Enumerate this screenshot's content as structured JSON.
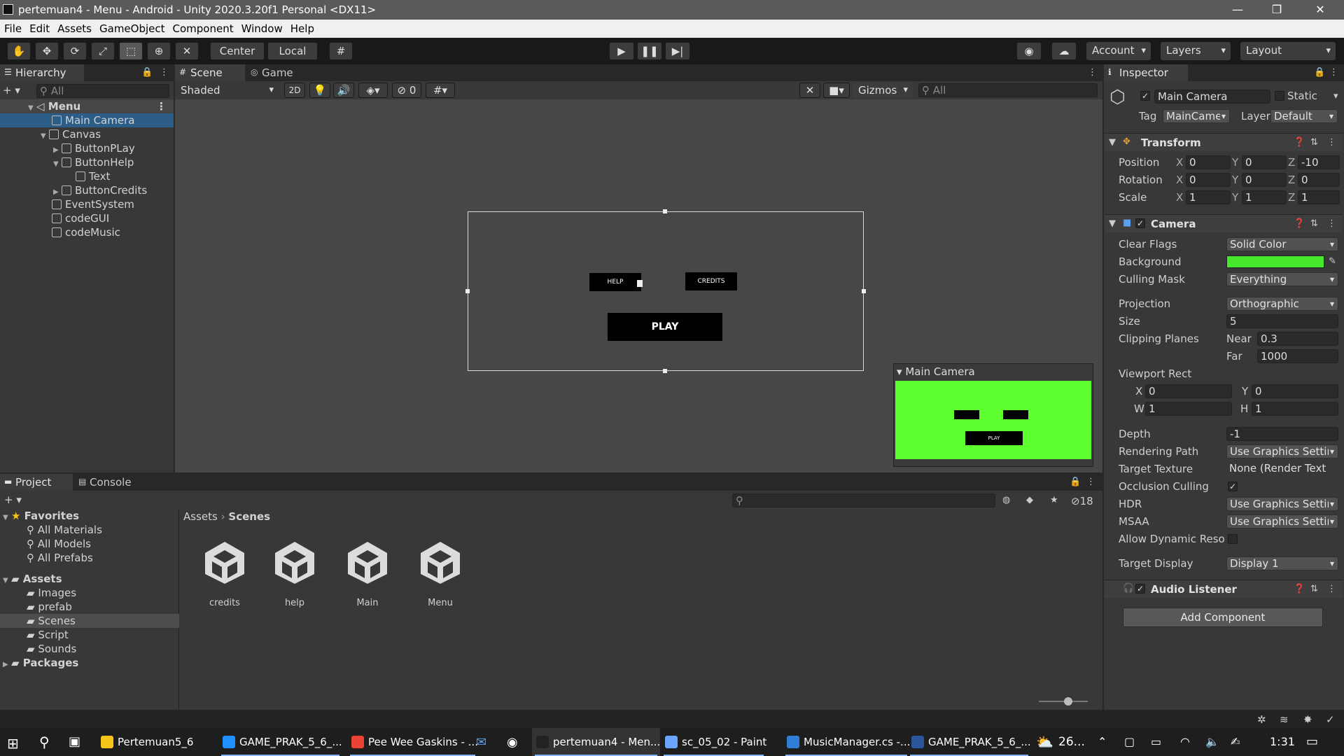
{
  "window": {
    "title": "pertemuan4 - Menu - Android - Unity 2020.3.20f1 Personal <DX11>",
    "minimize": "—",
    "maximize": "❐",
    "close": "✕"
  },
  "menu": [
    "File",
    "Edit",
    "Assets",
    "GameObject",
    "Component",
    "Window",
    "Help"
  ],
  "toolbar": {
    "center": "Center",
    "local": "Local",
    "account": "Account",
    "layers": "Layers",
    "layout": "Layout"
  },
  "hierarchy": {
    "tab": "Hierarchy",
    "search_placeholder": "All",
    "scene": "Menu",
    "items": [
      {
        "label": "Main Camera",
        "selected": true
      },
      {
        "label": "Canvas"
      },
      {
        "label": "ButtonPLay"
      },
      {
        "label": "ButtonHelp"
      },
      {
        "label": "Text"
      },
      {
        "label": "ButtonCredits"
      },
      {
        "label": "EventSystem"
      },
      {
        "label": "codeGUI"
      },
      {
        "label": "codeMusic"
      }
    ]
  },
  "scene": {
    "tabs": [
      "Scene",
      "Game"
    ],
    "shading": "Shaded",
    "mode2d": "2D",
    "hidden_count": "0",
    "gizmos": "Gizmos",
    "search_placeholder": "All",
    "buttons": {
      "help": "HELP",
      "credits": "CREDITS",
      "play": "PLAY"
    },
    "preview_title": "Main Camera",
    "preview_background": "#5dff2e"
  },
  "project": {
    "tabs": [
      "Project",
      "Console"
    ],
    "hidden_count": "18",
    "favorites_label": "Favorites",
    "favorites": [
      "All Materials",
      "All Models",
      "All Prefabs"
    ],
    "assets_label": "Assets",
    "asset_folders": [
      "Images",
      "prefab",
      "Scenes",
      "Script",
      "Sounds"
    ],
    "selected_folder": "Scenes",
    "packages_label": "Packages",
    "breadcrumb": [
      "Assets",
      "Scenes"
    ],
    "breadcrumb_sep": "›",
    "scene_assets": [
      "credits",
      "help",
      "Main",
      "Menu"
    ]
  },
  "inspector": {
    "tab": "Inspector",
    "object_name": "Main Camera",
    "static_label": "Static",
    "tag_label": "Tag",
    "tag_value": "MainCame",
    "layer_label": "Layer",
    "layer_value": "Default",
    "transform": {
      "title": "Transform",
      "position_label": "Position",
      "position": [
        "0",
        "0",
        "-10"
      ],
      "rotation_label": "Rotation",
      "rotation": [
        "0",
        "0",
        "0"
      ],
      "scale_label": "Scale",
      "scale": [
        "1",
        "1",
        "1"
      ],
      "axes": [
        "X",
        "Y",
        "Z"
      ]
    },
    "camera": {
      "title": "Camera",
      "clear_flags_label": "Clear Flags",
      "clear_flags": "Solid Color",
      "background_label": "Background",
      "background_color": "#45e82a",
      "culling_mask_label": "Culling Mask",
      "culling_mask": "Everything",
      "projection_label": "Projection",
      "projection": "Orthographic",
      "size_label": "Size",
      "size": "5",
      "clipping_label": "Clipping Planes",
      "near_label": "Near",
      "near": "0.3",
      "far_label": "Far",
      "far": "1000",
      "viewport_label": "Viewport Rect",
      "vp_x_label": "X",
      "vp_x": "0",
      "vp_y_label": "Y",
      "vp_y": "0",
      "vp_w_label": "W",
      "vp_w": "1",
      "vp_h_label": "H",
      "vp_h": "1",
      "depth_label": "Depth",
      "depth": "-1",
      "rendering_path_label": "Rendering Path",
      "rendering_path": "Use Graphics Settir",
      "target_texture_label": "Target Texture",
      "target_texture": "None (Render Text",
      "occlusion_label": "Occlusion Culling",
      "hdr_label": "HDR",
      "hdr": "Use Graphics Settir",
      "msaa_label": "MSAA",
      "msaa": "Use Graphics Settir",
      "dyn_res_label": "Allow Dynamic Reso",
      "target_display_label": "Target Display",
      "target_display": "Display 1"
    },
    "audio_listener": {
      "title": "Audio Listener"
    },
    "add_component": "Add Component"
  },
  "taskbar": {
    "tasks": [
      {
        "label": "Pertemuan5_6",
        "color": "#f5c518"
      },
      {
        "label": "GAME_PRAK_5_6_...",
        "color": "#1e90ff"
      },
      {
        "label": "Pee Wee Gaskins - ...",
        "color": "#ea4335"
      },
      {
        "label": "pertemuan4 - Men...",
        "color": "#222222"
      },
      {
        "label": "sc_05_02 - Paint",
        "color": "#6aa6ff"
      },
      {
        "label": "MusicManager.cs -...",
        "color": "#2f7fd8"
      },
      {
        "label": "GAME_PRAK_5_6_...",
        "color": "#2b579a"
      }
    ],
    "weather": "26...",
    "time": "1:31"
  }
}
